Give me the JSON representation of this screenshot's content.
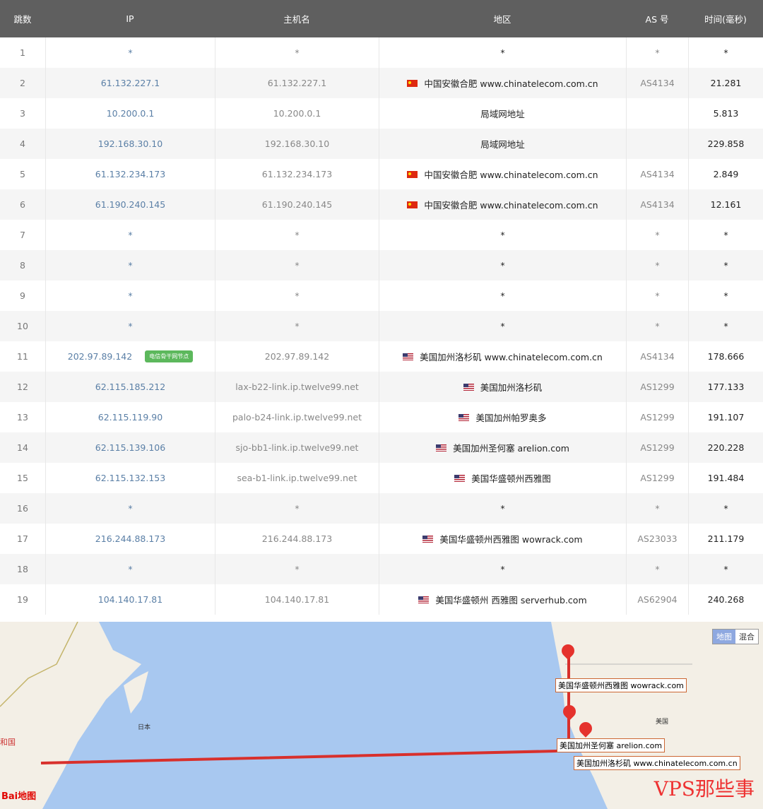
{
  "headers": [
    "跳数",
    "IP",
    "主机名",
    "地区",
    "AS 号",
    "时间(毫秒)"
  ],
  "rows": [
    {
      "hop": "1",
      "ip": "*",
      "host": "*",
      "flag": "",
      "region": "*",
      "as": "*",
      "time": "*",
      "badge": ""
    },
    {
      "hop": "2",
      "ip": "61.132.227.1",
      "host": "61.132.227.1",
      "flag": "cn",
      "region": "中国安徽合肥 www.chinatelecom.com.cn",
      "as": "AS4134",
      "time": "21.281",
      "badge": ""
    },
    {
      "hop": "3",
      "ip": "10.200.0.1",
      "host": "10.200.0.1",
      "flag": "",
      "region": "局域网地址",
      "as": "",
      "time": "5.813",
      "badge": ""
    },
    {
      "hop": "4",
      "ip": "192.168.30.10",
      "host": "192.168.30.10",
      "flag": "",
      "region": "局域网地址",
      "as": "",
      "time": "229.858",
      "badge": ""
    },
    {
      "hop": "5",
      "ip": "61.132.234.173",
      "host": "61.132.234.173",
      "flag": "cn",
      "region": "中国安徽合肥 www.chinatelecom.com.cn",
      "as": "AS4134",
      "time": "2.849",
      "badge": ""
    },
    {
      "hop": "6",
      "ip": "61.190.240.145",
      "host": "61.190.240.145",
      "flag": "cn",
      "region": "中国安徽合肥 www.chinatelecom.com.cn",
      "as": "AS4134",
      "time": "12.161",
      "badge": ""
    },
    {
      "hop": "7",
      "ip": "*",
      "host": "*",
      "flag": "",
      "region": "*",
      "as": "*",
      "time": "*",
      "badge": ""
    },
    {
      "hop": "8",
      "ip": "*",
      "host": "*",
      "flag": "",
      "region": "*",
      "as": "*",
      "time": "*",
      "badge": ""
    },
    {
      "hop": "9",
      "ip": "*",
      "host": "*",
      "flag": "",
      "region": "*",
      "as": "*",
      "time": "*",
      "badge": ""
    },
    {
      "hop": "10",
      "ip": "*",
      "host": "*",
      "flag": "",
      "region": "*",
      "as": "*",
      "time": "*",
      "badge": ""
    },
    {
      "hop": "11",
      "ip": "202.97.89.142",
      "host": "202.97.89.142",
      "flag": "us",
      "region": "美国加州洛杉矶 www.chinatelecom.com.cn",
      "as": "AS4134",
      "time": "178.666",
      "badge": "电信骨干网节点"
    },
    {
      "hop": "12",
      "ip": "62.115.185.212",
      "host": "lax-b22-link.ip.twelve99.net",
      "flag": "us",
      "region": "美国加州洛杉矶",
      "as": "AS1299",
      "time": "177.133",
      "badge": ""
    },
    {
      "hop": "13",
      "ip": "62.115.119.90",
      "host": "palo-b24-link.ip.twelve99.net",
      "flag": "us",
      "region": "美国加州帕罗奥多",
      "as": "AS1299",
      "time": "191.107",
      "badge": ""
    },
    {
      "hop": "14",
      "ip": "62.115.139.106",
      "host": "sjo-bb1-link.ip.twelve99.net",
      "flag": "us",
      "region": "美国加州圣何塞 arelion.com",
      "as": "AS1299",
      "time": "220.228",
      "badge": ""
    },
    {
      "hop": "15",
      "ip": "62.115.132.153",
      "host": "sea-b1-link.ip.twelve99.net",
      "flag": "us",
      "region": "美国华盛顿州西雅图",
      "as": "AS1299",
      "time": "191.484",
      "badge": ""
    },
    {
      "hop": "16",
      "ip": "*",
      "host": "*",
      "flag": "",
      "region": "*",
      "as": "*",
      "time": "*",
      "badge": ""
    },
    {
      "hop": "17",
      "ip": "216.244.88.173",
      "host": "216.244.88.173",
      "flag": "us",
      "region": "美国华盛顿州西雅图 wowrack.com",
      "as": "AS23033",
      "time": "211.179",
      "badge": ""
    },
    {
      "hop": "18",
      "ip": "*",
      "host": "*",
      "flag": "",
      "region": "*",
      "as": "*",
      "time": "*",
      "badge": ""
    },
    {
      "hop": "19",
      "ip": "104.140.17.81",
      "host": "104.140.17.81",
      "flag": "us",
      "region": "美国华盛顿州 西雅图 serverhub.com",
      "as": "AS62904",
      "time": "240.268",
      "badge": ""
    }
  ],
  "map": {
    "toggle_map": "地图",
    "toggle_hybrid": "混合",
    "label_seattle": "美国华盛顿州西雅图 wowrack.com",
    "label_sanjose": "美国加州圣何塞 arelion.com",
    "label_la": "美国加州洛杉矶 www.chinatelecom.com.cn",
    "place_japan": "日本",
    "place_usa": "美国",
    "place_left": "和国",
    "logo": "Bai地图",
    "watermark": "VPS那些事"
  }
}
